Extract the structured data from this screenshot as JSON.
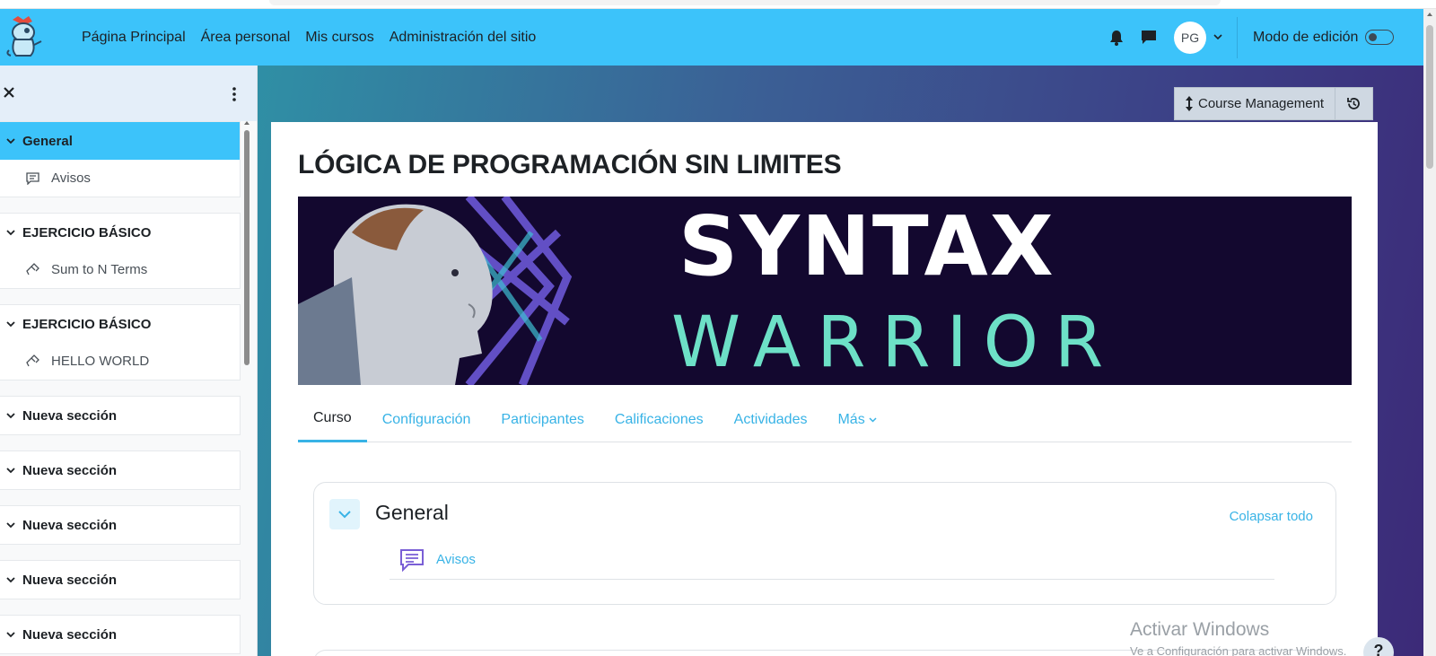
{
  "navbar": {
    "links": [
      "Página Principal",
      "Área personal",
      "Mis cursos",
      "Administración del sitio"
    ],
    "avatar_initials": "PG",
    "edit_mode_label": "Modo de edición",
    "edit_mode_on": false,
    "accent_color": "#3cc3fa"
  },
  "drawer": {
    "sections": [
      {
        "title": "General",
        "active": true,
        "items": [
          {
            "label": "Avisos",
            "icon": "forum-icon"
          }
        ]
      },
      {
        "title": "EJERCICIO BÁSICO",
        "items": [
          {
            "label": "Sum to N Terms",
            "icon": "code-runner-icon"
          }
        ]
      },
      {
        "title": "EJERCICIO BÁSICO",
        "items": [
          {
            "label": "HELLO WORLD",
            "icon": "code-runner-icon"
          }
        ]
      },
      {
        "title": "Nueva sección",
        "items": []
      },
      {
        "title": "Nueva sección",
        "items": []
      },
      {
        "title": "Nueva sección",
        "items": []
      },
      {
        "title": "Nueva sección",
        "items": []
      },
      {
        "title": "Nueva sección",
        "items": []
      }
    ]
  },
  "course": {
    "management_label": "Course Management",
    "title": "LÓGICA DE PROGRAMACIÓN SIN LIMITES",
    "banner": {
      "line1": "SYNTAX",
      "line2": "WARRIOR"
    },
    "tabs": [
      "Curso",
      "Configuración",
      "Participantes",
      "Calificaciones",
      "Actividades",
      "Más"
    ],
    "active_tab": 0
  },
  "general_section": {
    "title": "General",
    "collapse_all": "Colapsar todo",
    "activity_label": "Avisos"
  },
  "watermark": {
    "line1": "Activar Windows",
    "line2": "Ve a Configuración para activar Windows."
  },
  "help_label": "?"
}
